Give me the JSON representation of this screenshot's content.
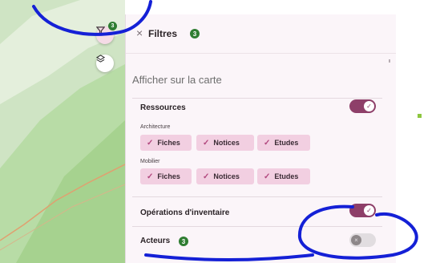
{
  "map": {
    "filter_badge": "3",
    "colors": {
      "base": "#cfe4c4",
      "dark": "#a9d395",
      "light": "#e8f2e1",
      "road": "#e0a070"
    }
  },
  "panel": {
    "title": "Filtres",
    "title_badge": "3",
    "section_title": "Afficher sur la carte",
    "ressources": {
      "label": "Ressources",
      "toggle_on": true,
      "groups": [
        {
          "label": "Architecture",
          "chips": [
            "Fiches",
            "Notices",
            "Etudes"
          ]
        },
        {
          "label": "Mobilier",
          "chips": [
            "Fiches",
            "Notices",
            "Etudes"
          ]
        }
      ]
    },
    "operations": {
      "label": "Opérations d'inventaire",
      "toggle_on": true
    },
    "acteurs": {
      "label": "Acteurs",
      "badge": "3",
      "toggle_on": false
    }
  },
  "colors": {
    "accent": "#8e3f69",
    "chip_bg": "#f2cfe1",
    "badge_green": "#2f7d32",
    "annotation_blue": "#1420d6"
  }
}
